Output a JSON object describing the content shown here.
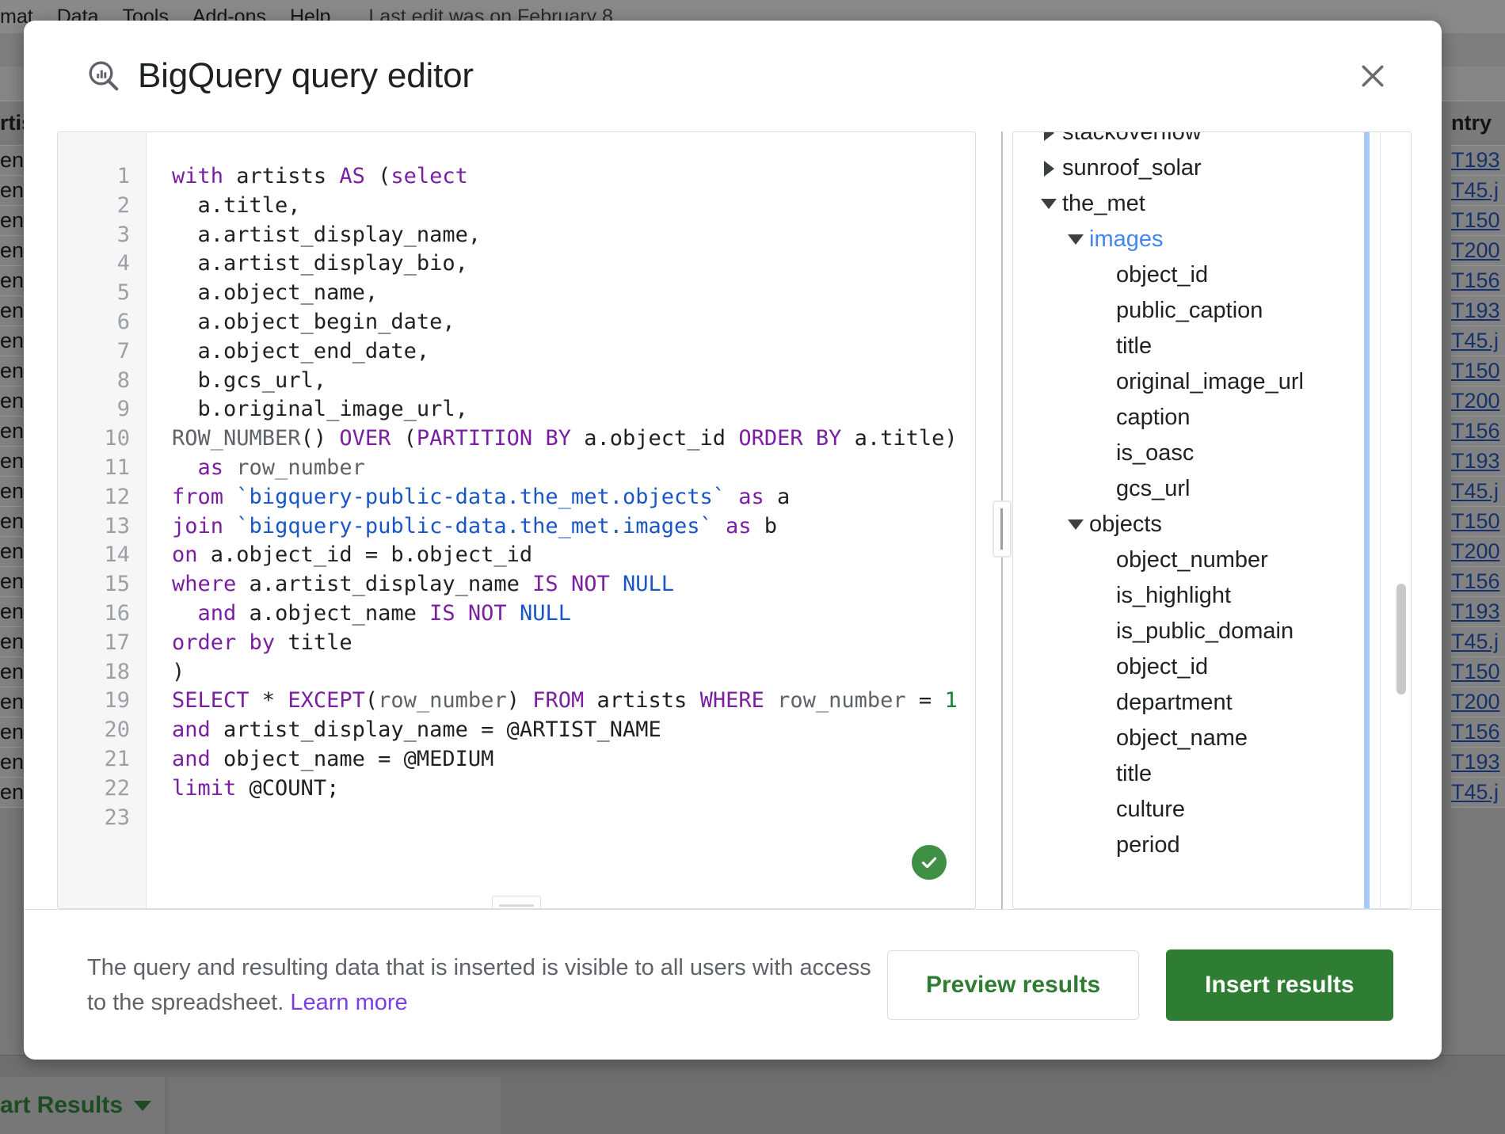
{
  "background": {
    "menubar": {
      "items": [
        "mat",
        "Data",
        "Tools",
        "Add-ons",
        "Help"
      ],
      "last_edit": "Last edit was on February 8"
    },
    "left_column": {
      "header": "rtist",
      "cells": [
        "end",
        "end",
        "end",
        "end",
        "end",
        "end",
        "end",
        "end",
        "end",
        "end",
        "end",
        "end",
        "end",
        "end",
        "end",
        "end",
        "end",
        "end",
        "end",
        "end",
        "end",
        "end"
      ]
    },
    "right_column": {
      "header": "ntry",
      "cells": [
        "T193",
        "T45.j",
        "T150",
        "T200",
        "T156",
        "T193",
        "T45.j",
        "T150",
        "T200",
        "T156",
        "T193",
        "T45.j",
        "T150",
        "T200",
        "T156",
        "T193",
        "T45.j",
        "T150",
        "T200",
        "T156",
        "T193",
        "T45.j"
      ]
    },
    "sheet_tab": "art Results"
  },
  "dialog": {
    "title": "BigQuery query editor",
    "icon": "bigquery-search-icon",
    "close_icon": "close-icon"
  },
  "editor": {
    "line_count": 23,
    "line_numbers": [
      "1",
      "2",
      "3",
      "4",
      "5",
      "6",
      "7",
      "8",
      "9",
      "10",
      "11",
      "12",
      "13",
      "14",
      "15",
      "16",
      "17",
      "18",
      "19",
      "20",
      "21",
      "22",
      "23"
    ],
    "sql_plain": "with artists AS (select\n  a.title,\n  a.artist_display_name,\n  a.artist_display_bio,\n  a.object_name,\n  a.object_begin_date,\n  a.object_end_date,\n  b.gcs_url,\n  b.original_image_url,\nROW_NUMBER() OVER (PARTITION BY a.object_id ORDER BY a.title)\n  as row_number\nfrom `bigquery-public-data.the_met.objects` as a\njoin `bigquery-public-data.the_met.images` as b\non a.object_id = b.object_id\nwhere a.artist_display_name IS NOT NULL\n  and a.object_name IS NOT NULL\norder by title\n)\nSELECT * EXCEPT(row_number) FROM artists WHERE row_number = 1\nand artist_display_name = @ARTIST_NAME\nand object_name = @MEDIUM\nlimit @COUNT;\n",
    "validation_icon": "green-check-circle-icon",
    "colors": {
      "keyword": "#7b1fa2",
      "table_ref": "#1a56c4",
      "number": "#188038",
      "valid_badge": "#3f8f45"
    }
  },
  "schema": {
    "nodes": [
      {
        "label": "stackoverflow",
        "indent": 0,
        "state": "collapsed",
        "type": "dataset",
        "clipped": true
      },
      {
        "label": "sunroof_solar",
        "indent": 0,
        "state": "collapsed",
        "type": "dataset"
      },
      {
        "label": "the_met",
        "indent": 0,
        "state": "expanded",
        "type": "dataset"
      },
      {
        "label": "images",
        "indent": 1,
        "state": "expanded",
        "type": "table",
        "selected": true
      },
      {
        "label": "object_id",
        "indent": 2,
        "state": "none",
        "type": "field"
      },
      {
        "label": "public_caption",
        "indent": 2,
        "state": "none",
        "type": "field"
      },
      {
        "label": "title",
        "indent": 2,
        "state": "none",
        "type": "field"
      },
      {
        "label": "original_image_url",
        "indent": 2,
        "state": "none",
        "type": "field"
      },
      {
        "label": "caption",
        "indent": 2,
        "state": "none",
        "type": "field"
      },
      {
        "label": "is_oasc",
        "indent": 2,
        "state": "none",
        "type": "field"
      },
      {
        "label": "gcs_url",
        "indent": 2,
        "state": "none",
        "type": "field"
      },
      {
        "label": "objects",
        "indent": 1,
        "state": "expanded",
        "type": "table"
      },
      {
        "label": "object_number",
        "indent": 2,
        "state": "none",
        "type": "field"
      },
      {
        "label": "is_highlight",
        "indent": 2,
        "state": "none",
        "type": "field"
      },
      {
        "label": "is_public_domain",
        "indent": 2,
        "state": "none",
        "type": "field"
      },
      {
        "label": "object_id",
        "indent": 2,
        "state": "none",
        "type": "field"
      },
      {
        "label": "department",
        "indent": 2,
        "state": "none",
        "type": "field"
      },
      {
        "label": "object_name",
        "indent": 2,
        "state": "none",
        "type": "field"
      },
      {
        "label": "title",
        "indent": 2,
        "state": "none",
        "type": "field"
      },
      {
        "label": "culture",
        "indent": 2,
        "state": "none",
        "type": "field"
      },
      {
        "label": "period",
        "indent": 2,
        "state": "none",
        "type": "field"
      }
    ]
  },
  "footer": {
    "note_text": "The query and resulting data that is inserted is visible to all users with access to the spreadsheet. ",
    "learn_more": "Learn more",
    "preview_label": "Preview results",
    "insert_label": "Insert results",
    "colors": {
      "primary": "#2e7d32",
      "link": "#7b3fe4"
    }
  }
}
